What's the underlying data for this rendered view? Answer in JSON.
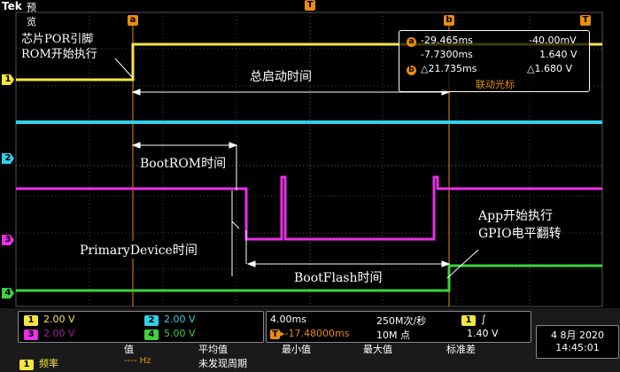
{
  "header": {
    "brand": "Tek",
    "mode": "预览"
  },
  "cursors": {
    "a_label": "a",
    "b_label": "b",
    "t_label": "T"
  },
  "channel_markers": {
    "ch1": "1",
    "ch2": "2",
    "ch3": "3",
    "ch4": "4"
  },
  "cursor_readout": {
    "a_time": "-29.465ms",
    "a_volt": "-40.00mV",
    "b_time": "-7.7300ms",
    "b_volt": "1.640 V",
    "delta_time": "△21.735ms",
    "delta_volt": "△1.680 V",
    "link_label": "联动光标"
  },
  "annotations": {
    "por": "芯片POR引脚\nROM开始执行",
    "total": "总启动时间",
    "bootrom": "BootROM时间",
    "primary": "PrimaryDevice时间",
    "bootflash": "BootFlash时间",
    "app": "App开始执行\nGPIO电平翻转"
  },
  "channels": [
    {
      "num": "1",
      "scale": "2.00 V",
      "color": "#f5e642"
    },
    {
      "num": "2",
      "scale": "2.00 V",
      "color": "#30d0e8"
    },
    {
      "num": "3",
      "scale": "2.00 V",
      "color": "#e830e8"
    },
    {
      "num": "4",
      "scale": "5.00 V",
      "color": "#40d040"
    }
  ],
  "timebase": {
    "time_div": "4.00ms",
    "sample_rate": "250M次/秒",
    "trigger_pos": "-17.48000ms",
    "record_length": "10M 点",
    "trigger_channel": "1",
    "trigger_slope": "∫",
    "trigger_level": "1.40 V"
  },
  "measurement": {
    "headers": [
      "值",
      "平均值",
      "最小值",
      "最大值",
      "标准差"
    ],
    "row_label": "频率",
    "row_channel": "1",
    "value": "---- Hz",
    "status": "未发现周期"
  },
  "datetime": {
    "date": "4 8月 2020",
    "time": "14:45:01"
  },
  "colors": {
    "ch1": "#f5e642",
    "ch2": "#30d0e8",
    "ch3": "#e830e8",
    "ch4": "#40d040",
    "cursor": "#e88d0c"
  }
}
